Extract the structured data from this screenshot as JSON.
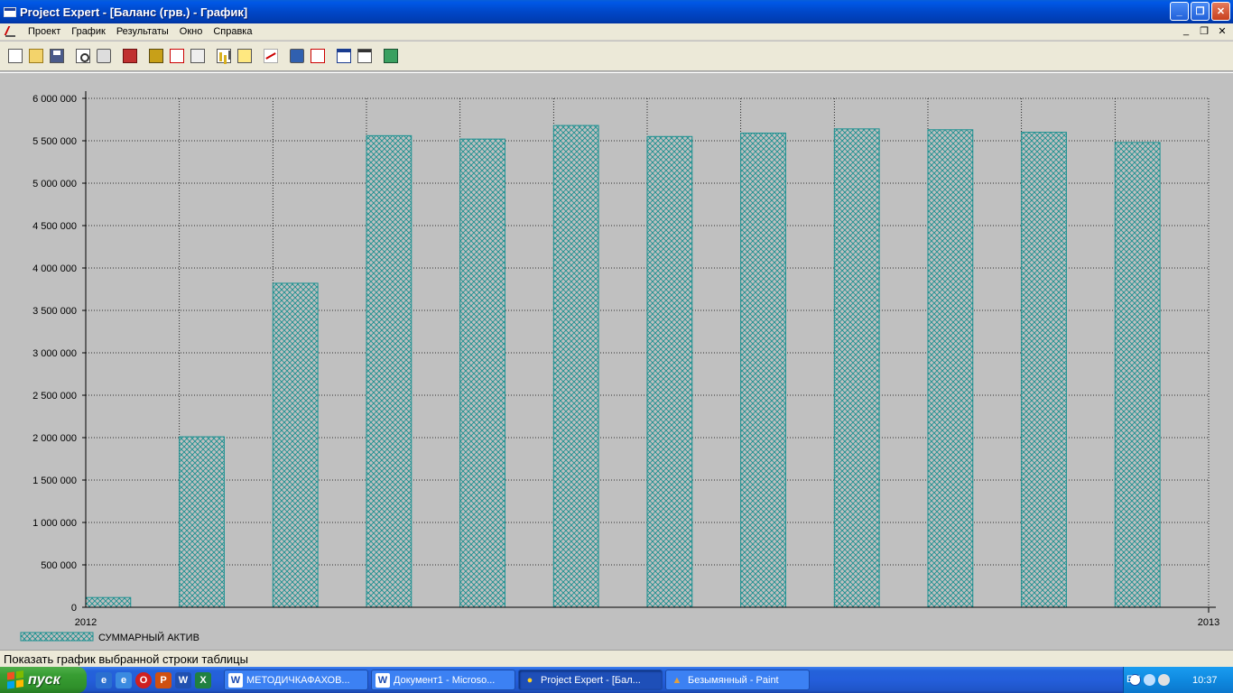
{
  "window": {
    "title": "Project Expert - [Баланс (грв.) - График]",
    "buttons": {
      "minimize": "_",
      "maximize": "❐",
      "close": "✕"
    }
  },
  "menu": {
    "items": [
      "Проект",
      "График",
      "Результаты",
      "Окно",
      "Справка"
    ],
    "mdi_buttons": [
      "_",
      "❐",
      "✕"
    ]
  },
  "toolbar": {
    "icons": [
      "new-document-icon",
      "open-folder-icon",
      "save-icon",
      "print-preview-icon",
      "print-icon",
      "exit-icon",
      "book-icon",
      "cash-flow-icon",
      "scales-icon",
      "bar-chart-icon",
      "notes-icon",
      "line-chart-icon",
      "globe-icon",
      "pdf-icon",
      "window-icon",
      "window-list-icon",
      "multi-window-icon"
    ]
  },
  "chart_data": {
    "type": "bar",
    "categories": [
      "",
      "",
      "",
      "",
      "",
      "",
      "",
      "",
      "",
      "",
      "",
      ""
    ],
    "series": [
      {
        "name": "СУММАРНЫЙ АКТИВ",
        "values": [
          115000,
          2010000,
          3820000,
          5560000,
          5520000,
          5680000,
          5550000,
          5590000,
          5640000,
          5630000,
          5600000,
          5480000
        ]
      }
    ],
    "ylim": [
      0,
      6000000
    ],
    "yticks": [
      "0",
      "500 000",
      "1 000 000",
      "1 500 000",
      "2 000 000",
      "2 500 000",
      "3 000 000",
      "3 500 000",
      "4 000 000",
      "4 500 000",
      "5 000 000",
      "5 500 000",
      "6 000 000"
    ],
    "xtick_labels": [
      "2012",
      "2013"
    ],
    "grid": true,
    "legend": "bottom-left",
    "bar_color": "#1a9090",
    "background": "#c0c0c0"
  },
  "statusbar": {
    "text": "Показать график выбранной строки таблицы"
  },
  "taskbar": {
    "start_label": "пуск",
    "quick_launch": [
      "ie-icon",
      "ie-icon",
      "opera-icon",
      "powerpoint-icon",
      "word-icon",
      "excel-icon"
    ],
    "tasks": [
      {
        "label": "МЕТОДИЧКАФАХОВ...",
        "icon": "W"
      },
      {
        "label": "Документ1 - Microso...",
        "icon": "W"
      },
      {
        "label": "Project Expert - [Бал...",
        "icon": "PE"
      },
      {
        "label": "Безымянный - Paint",
        "icon": "P"
      }
    ],
    "language": "EN",
    "clock": "10:37"
  }
}
